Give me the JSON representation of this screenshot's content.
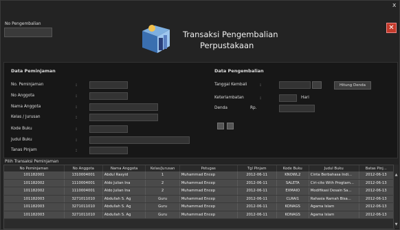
{
  "window": {
    "close_glyph": "x"
  },
  "header": {
    "no_pengembalian_label": "No Pengembalian",
    "no_pengembalian_value": "",
    "title_line1": "Transaksi Pengembalian",
    "title_line2": "Perpustakaan",
    "icon": "book-icon",
    "cancel_glyph": "✕"
  },
  "peminjaman": {
    "section_title": "Data Peminjaman",
    "fields": [
      {
        "label": "No. Peminjaman",
        "value": ""
      },
      {
        "label": "No Anggota",
        "value": ""
      },
      {
        "label": "Nama Anggota",
        "value": ""
      },
      {
        "label": "Kelas / Jurusan",
        "value": ""
      },
      {
        "label": "Kode Buku",
        "value": ""
      },
      {
        "label": "Judul Buku",
        "value": ""
      },
      {
        "label": "Tanas Pinjam",
        "value": ""
      }
    ]
  },
  "pengembalian": {
    "section_title": "Data Pengembalian",
    "tanggal_label": "Tanggal Kembali",
    "tanggal_value": "",
    "hitung_button": "Hitung Denda",
    "keterlambatan_label": "Keterlambatan",
    "keterlambatan_value": "",
    "hari_label": "Hari",
    "denda_label": "Denda",
    "rp_label": "Rp.",
    "denda_value": ""
  },
  "table": {
    "title": "Pilih Transaksi Peminjaman",
    "columns": [
      "No Peminjaman",
      "No Anggota",
      "Nama Anggota",
      "Kelas/Jurusan",
      "Petugas",
      "Tgl Pinjam",
      "Kode Buku",
      "Judul Buku",
      "Batas Pinj..."
    ],
    "rows": [
      [
        "101182001",
        "1310004001",
        "Abdul Rasyid",
        "1",
        "Muhammad Encep",
        "2012-06-11",
        "KNOWL2",
        "Cinta Berbahasa Indi...",
        "2012-06-13"
      ],
      [
        "101182002",
        "1110004001",
        "Aldo Julian Ina",
        "2",
        "Muhammad Encep",
        "2012-06-11",
        "SALETA",
        "Ciri-cite With Progtam...",
        "2012-06-13"
      ],
      [
        "101182002",
        "1110004001",
        "Aldo Julian Ina",
        "2",
        "Muhammad Encep",
        "2012-06-11",
        "EXMAIO",
        "Modifikasi Desain Sa...",
        "2012-06-13"
      ],
      [
        "101182003",
        "3271011010",
        "Abdullah S. Ag",
        "Guru",
        "Muhammad Encep",
        "2012-06-11",
        "CLRAI1",
        "Rahasia Ramah Bisa...",
        "2012-06-13"
      ],
      [
        "101182003",
        "3271011010",
        "Abdullah S. Ag",
        "Guru",
        "Muhammad Encep",
        "2012-06-11",
        "KONAGS",
        "Agama Islam",
        "2012-06-13"
      ],
      [
        "101182003",
        "3271011010",
        "Abdullah S. Ag",
        "Guru",
        "Muhammad Encep",
        "2012-06-11",
        "KONAGS",
        "Agama Islam",
        "2012-06-13"
      ]
    ]
  }
}
